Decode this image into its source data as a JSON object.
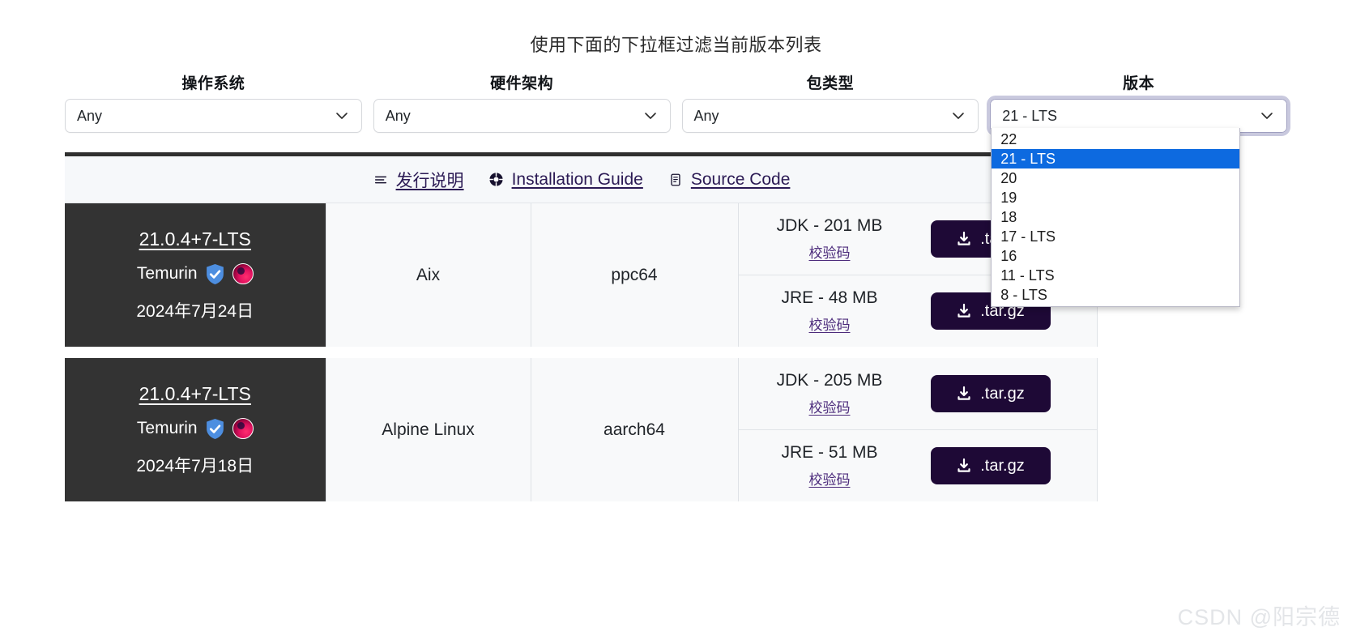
{
  "heading": "使用下面的下拉框过滤当前版本列表",
  "filters": [
    {
      "label": "操作系统",
      "value": "Any",
      "name": "os"
    },
    {
      "label": "硬件架构",
      "value": "Any",
      "name": "arch"
    },
    {
      "label": "包类型",
      "value": "Any",
      "name": "package-type"
    },
    {
      "label": "版本",
      "value": "21 - LTS",
      "name": "version"
    }
  ],
  "version_dropdown": {
    "open": true,
    "selected": "21 - LTS",
    "options": [
      "22",
      "21 - LTS",
      "20",
      "19",
      "18",
      "17 - LTS",
      "16",
      "11 - LTS",
      "8 - LTS"
    ]
  },
  "doc_links": [
    {
      "icon": "release-notes-icon",
      "label": "发行说明"
    },
    {
      "icon": "installation-guide-icon",
      "label": "Installation Guide"
    },
    {
      "icon": "source-code-icon",
      "label": "Source Code"
    }
  ],
  "table": {
    "rows": [
      {
        "version": "21.0.4+7-LTS",
        "vendor": "Temurin",
        "date": "2024年7月24日",
        "os": "Aix",
        "arch": "ppc64",
        "packages": [
          {
            "size": "JDK - 201 MB",
            "checksum": "校验码",
            "download": ".tar.gz"
          },
          {
            "size": "JRE - 48 MB",
            "checksum": "校验码",
            "download": ".tar.gz"
          }
        ]
      },
      {
        "version": "21.0.4+7-LTS",
        "vendor": "Temurin",
        "date": "2024年7月18日",
        "os": "Alpine Linux",
        "arch": "aarch64",
        "packages": [
          {
            "size": "JDK - 205 MB",
            "checksum": "校验码",
            "download": ".tar.gz"
          },
          {
            "size": "JRE - 51 MB",
            "checksum": "校验码",
            "download": ".tar.gz"
          }
        ]
      }
    ]
  },
  "watermark": "CSDN @阳宗德",
  "colors": {
    "selected_option_bg": "#0d6ae0",
    "dark_cell_bg": "#333333",
    "download_button_bg": "#1e0936",
    "link_purple": "#2b1a54"
  }
}
